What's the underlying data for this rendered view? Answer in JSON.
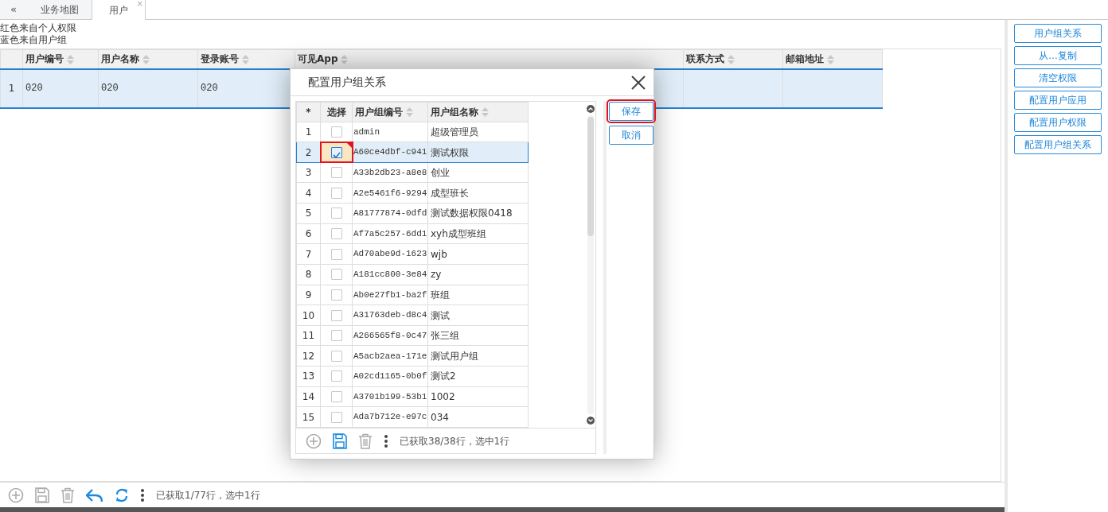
{
  "tabs": {
    "collapse": "«",
    "items": [
      {
        "label": "业务地图",
        "selected": false
      },
      {
        "label": "用户",
        "selected": true,
        "close": "×"
      }
    ]
  },
  "legend": [
    "红色来自个人权限",
    "蓝色来自用户组"
  ],
  "main_table": {
    "columns": [
      "用户编号",
      "用户名称",
      "登录账号",
      "可见App",
      "联系方式",
      "邮箱地址"
    ],
    "rows": [
      {
        "index": "1",
        "cells": [
          "020",
          "020",
          "020"
        ],
        "selected": true
      }
    ]
  },
  "main_toolbar": {
    "tools": [
      {
        "kind": "add",
        "disabled": true
      },
      {
        "kind": "save",
        "disabled": true
      },
      {
        "kind": "delete",
        "disabled": true
      },
      {
        "kind": "undo",
        "disabled": false
      },
      {
        "kind": "refresh",
        "disabled": false
      },
      {
        "kind": "more"
      }
    ],
    "status": "已获取1/77行，选中1行"
  },
  "side_buttons": [
    "用户组关系",
    "从...复制",
    "清空权限",
    "配置用户应用",
    "配置用户权限",
    "配置用户组关系"
  ],
  "dialog": {
    "title": "配置用户组关系",
    "columns": [
      "*",
      "选择",
      "用户组编号",
      "用户组名称"
    ],
    "rows": [
      {
        "index": "1",
        "checked": false,
        "selected": false,
        "modified": false,
        "highlighted": false,
        "code": "admin",
        "name": "超级管理员"
      },
      {
        "index": "2",
        "checked": true,
        "selected": true,
        "modified": true,
        "highlighted": true,
        "code": "A60ce4dbf-c941",
        "name": "测试权限"
      },
      {
        "index": "3",
        "checked": false,
        "selected": false,
        "modified": false,
        "highlighted": false,
        "code": "A33b2db23-a8e8",
        "name": "创业"
      },
      {
        "index": "4",
        "checked": false,
        "selected": false,
        "modified": false,
        "highlighted": false,
        "code": "A2e5461f6-9294",
        "name": "成型班长"
      },
      {
        "index": "5",
        "checked": false,
        "selected": false,
        "modified": false,
        "highlighted": false,
        "code": "A81777874-0dfd",
        "name": "测试数据权限0418"
      },
      {
        "index": "6",
        "checked": false,
        "selected": false,
        "modified": false,
        "highlighted": false,
        "code": "Af7a5c257-6dd1",
        "name": "xyh成型班组"
      },
      {
        "index": "7",
        "checked": false,
        "selected": false,
        "modified": false,
        "highlighted": false,
        "code": "Ad70abe9d-1623",
        "name": "wjb"
      },
      {
        "index": "8",
        "checked": false,
        "selected": false,
        "modified": false,
        "highlighted": false,
        "code": "A181cc800-3e84",
        "name": "zy"
      },
      {
        "index": "9",
        "checked": false,
        "selected": false,
        "modified": false,
        "highlighted": false,
        "code": "Ab0e27fb1-ba2f",
        "name": "班组"
      },
      {
        "index": "10",
        "checked": false,
        "selected": false,
        "modified": false,
        "highlighted": false,
        "code": "A31763deb-d8c4",
        "name": "测试"
      },
      {
        "index": "11",
        "checked": false,
        "selected": false,
        "modified": false,
        "highlighted": false,
        "code": "A266565f8-0c47",
        "name": "张三组"
      },
      {
        "index": "12",
        "checked": false,
        "selected": false,
        "modified": false,
        "highlighted": false,
        "code": "A5acb2aea-171e",
        "name": "测试用户组"
      },
      {
        "index": "13",
        "checked": false,
        "selected": false,
        "modified": false,
        "highlighted": false,
        "code": "A02cd1165-0b0f",
        "name": "测试2"
      },
      {
        "index": "14",
        "checked": false,
        "selected": false,
        "modified": false,
        "highlighted": false,
        "code": "A3701b199-53b1",
        "name": "1002"
      },
      {
        "index": "15",
        "checked": false,
        "selected": false,
        "modified": false,
        "highlighted": false,
        "code": "Ada7b712e-e97c",
        "name": "034"
      }
    ],
    "actions": [
      {
        "label": "保存",
        "highlighted": true
      },
      {
        "label": "取消",
        "highlighted": false
      }
    ],
    "toolbar": {
      "tools": [
        {
          "kind": "add",
          "disabled": true
        },
        {
          "kind": "save",
          "disabled": false
        },
        {
          "kind": "delete",
          "disabled": true
        },
        {
          "kind": "more"
        }
      ],
      "status": "已获取38/38行，选中1行"
    }
  }
}
